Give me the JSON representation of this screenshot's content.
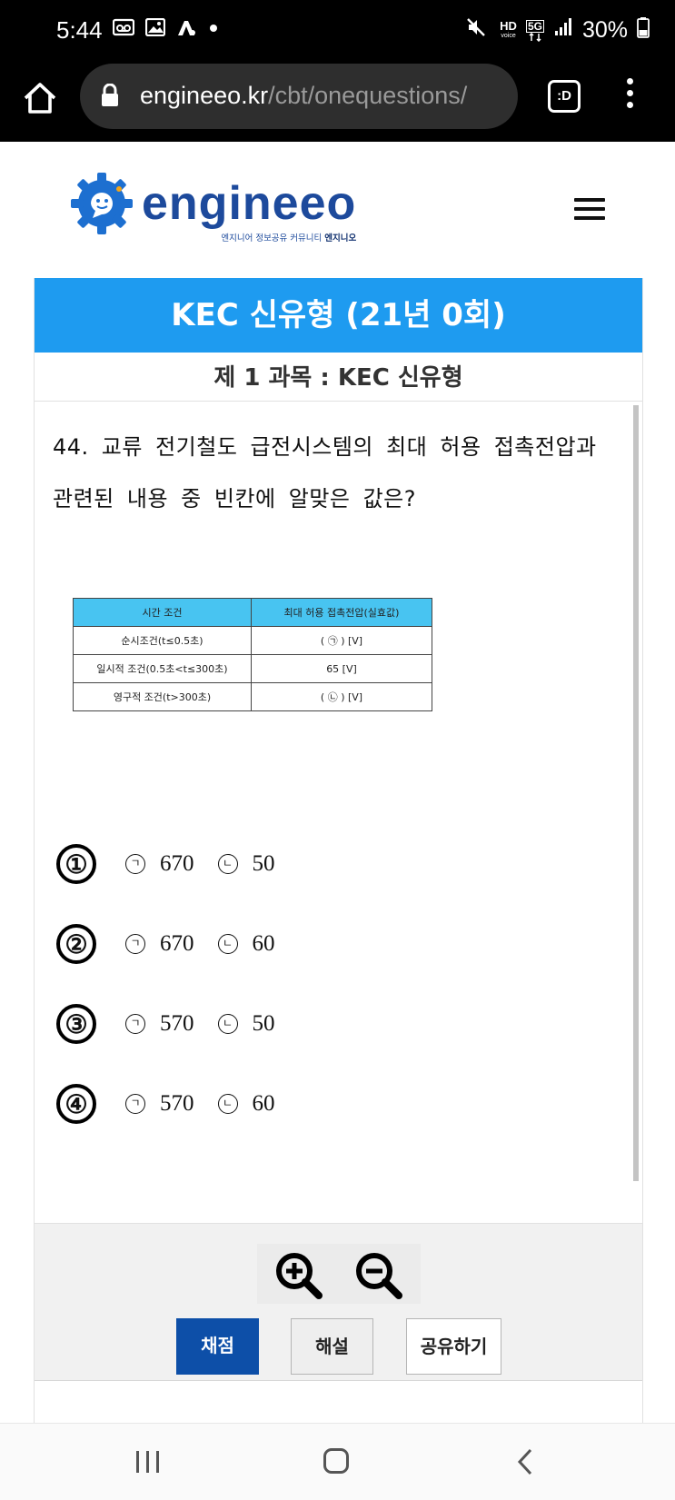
{
  "status_bar": {
    "time": "5:44",
    "battery_pct": "30%",
    "left_icons": [
      "voicemail-icon",
      "gallery-icon",
      "app-icon",
      "notification-dot-icon"
    ],
    "right_icons": [
      "mute-icon",
      "hd-voice-icon",
      "5g-icon",
      "signal-icon",
      "battery-icon"
    ],
    "hd_label": "HD",
    "voice_label": "voice",
    "net_label": "5G"
  },
  "browser": {
    "url_domain": "engineeo.kr",
    "url_path": "/cbt/onequestions/",
    "tabs_label": ":D"
  },
  "site": {
    "logo_text": "engineeo",
    "logo_tagline": "엔지니어 정보공유 커뮤니티",
    "logo_tagline_bold": "엔지니오",
    "brand_color": "#1d4a9c"
  },
  "exam": {
    "title": "KEC 신유형 (21년 0회)",
    "subject": "제 1 과목 : KEC 신유형",
    "header_color": "#1e9bf0"
  },
  "question": {
    "text": "44. 교류 전기철도 급전시스템의 최대 허용 접촉전압과 관련된 내용 중 빈칸에 알맞은 값은?",
    "table": {
      "headers": [
        "시간 조건",
        "최대 허용 접촉전압(실효값)"
      ],
      "rows": [
        [
          "순시조건(t≤0.5초)",
          "(  ㉠  ) [V]"
        ],
        [
          "일시적 조건(0.5초<t≤300초)",
          "65 [V]"
        ],
        [
          "영구적 조건(t>300초)",
          "(  ㉡  ) [V]"
        ]
      ],
      "header_color": "#48c4f1"
    }
  },
  "choices": [
    {
      "num": "①",
      "a_marker": "ㄱ",
      "a_value": "670",
      "b_marker": "ㄴ",
      "b_value": "50"
    },
    {
      "num": "②",
      "a_marker": "ㄱ",
      "a_value": "670",
      "b_marker": "ㄴ",
      "b_value": "60"
    },
    {
      "num": "③",
      "a_marker": "ㄱ",
      "a_value": "570",
      "b_marker": "ㄴ",
      "b_value": "50"
    },
    {
      "num": "④",
      "a_marker": "ㄱ",
      "a_value": "570",
      "b_marker": "ㄴ",
      "b_value": "60"
    }
  ],
  "actions": {
    "zoom_in_icon": "zoom-in-icon",
    "zoom_out_icon": "zoom-out-icon",
    "grade_label": "채점",
    "explain_label": "해설",
    "share_label": "공유하기",
    "grade_color": "#0d4fa8"
  },
  "nav_bar": {
    "icons": [
      "recent-apps-icon",
      "home-icon",
      "back-icon"
    ]
  }
}
